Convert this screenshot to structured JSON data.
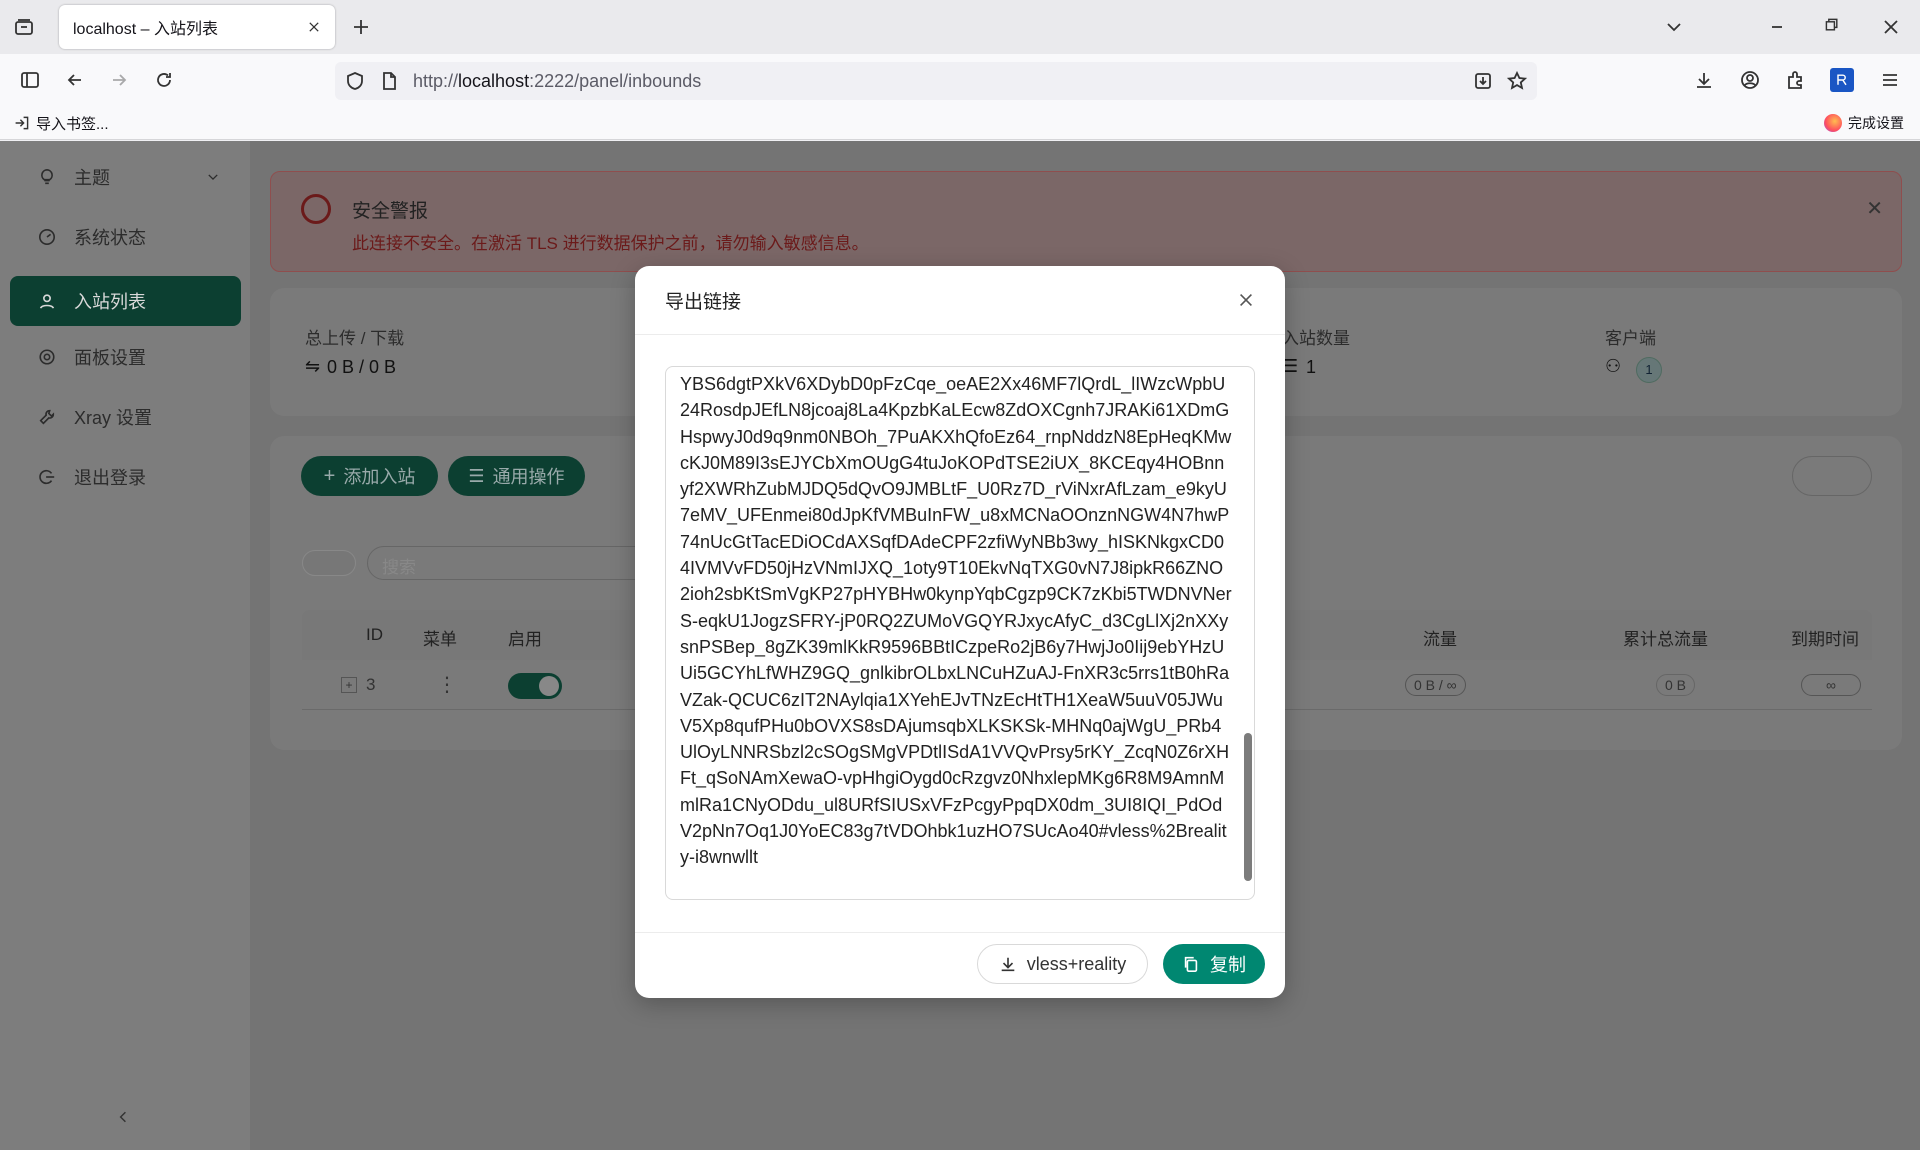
{
  "browser": {
    "tab_title": "localhost – 入站列表",
    "url_prefix": "http://",
    "url_host": "localhost",
    "url_rest": ":2222/panel/inbounds",
    "bookmark_import": "导入书签...",
    "finish_setup": "完成设置"
  },
  "sidebar": {
    "items": [
      {
        "label": "主题"
      },
      {
        "label": "系统状态"
      },
      {
        "label": "入站列表"
      },
      {
        "label": "面板设置"
      },
      {
        "label": "Xray 设置"
      },
      {
        "label": "退出登录"
      }
    ]
  },
  "alert": {
    "title": "安全警报",
    "message": "此连接不安全。在激活 TLS 进行数据保护之前，请勿输入敏感信息。"
  },
  "stats": {
    "upload_download_label": "总上传 / 下载",
    "upload_download_value": "0 B / 0 B",
    "inbound_count_label": "入站数量",
    "inbound_count_value": "1",
    "clients_label": "客户端",
    "clients_value": "1"
  },
  "toolbar": {
    "add_inbound": "添加入站",
    "general_actions": "通用操作",
    "search_placeholder": "搜索"
  },
  "table": {
    "headers": {
      "id": "ID",
      "menu": "菜单",
      "enable": "启用",
      "traffic": "流量",
      "total_traffic": "累计总流量",
      "expiry": "到期时间"
    },
    "row": {
      "id": "3",
      "traffic": "0 B / ∞",
      "total_traffic": "0 B",
      "expiry": "∞"
    }
  },
  "modal": {
    "title": "导出链接",
    "link_text": "YBS6dgtPXkV6XDybD0pFzCqe_oeAE2Xx46MF7lQrdL_lIWzcWpbU24RosdpJEfLN8jcoaj8La4KpzbKaLEcw8ZdOXCgnh7JRAKi61XDmGHspwyJ0d9q9nm0NBOh_7PuAKXhQfoEz64_rnpNddzN8EpHeqKMwcKJ0M89I3sEJYCbXmOUgG4tuJoKOPdTSE2iUX_8KCEqy4HOBnnyf2XWRhZubMJDQ5dQvO9JMBLtF_U0Rz7D_rViNxrAfLzam_e9kyU7eMV_UFEnmei80dJpKfVMBuInFW_u8xMCNaOOnznNGW4N7hwP74nUcGtTacEDiOCdAXSqfDAdeCPF2zfiWyNBb3wy_hISKNkgxCD04IVMVvFD50jHzVNmIJXQ_1oty9T10EkvNqTXG0vN7J8ipkR66ZNO2ioh2sbKtSmVgKP27pHYBHw0kynpYqbCgzp9CK7zKbi5TWDNVNerS-eqkU1JogzSFRY-jP0RQ2ZUMoVGQYRJxycAfyC_d3CgLlXj2nXXysnPSBep_8gZK39mlKkR9596BBtICzpeRo2jB6y7HwjJo0Iij9ebYHzUUi5GCYhLfWHZ9GQ_gnlkibrOLbxLNCuHZuAJ-FnXR3c5rrs1tB0hRaVZak-QCUC6zIT2NAylqia1XYehEJvTNzEcHtTH1XeaW5uuV05JWuV5Xp8qufPHu0bOVXS8sDAjumsqbXLKSKSk-MHNq0ajWgU_PRb4UlOyLNNRSbzl2cSOgSMgVPDtlISdA1VVQvPrsy5rKY_ZcqN0Z6rXHFt_qSoNAmXewaO-vpHhgiOygd0cRzgvz0NhxlepMKg6R8M9AmnMmlRa1CNyODdu_ul8URfSIUSxVFzPcgyPpqDX0dm_3UI8IQI_PdOdV2pNn7Oq1J0YoEC83g7tVDOhbk1uzHO7SUcAo40#vless%2Breality-i8wnwllt",
    "download_label": "vless+reality",
    "copy_label": "复制"
  },
  "colors": {
    "primary": "#008771",
    "danger": "#d32f2f"
  }
}
